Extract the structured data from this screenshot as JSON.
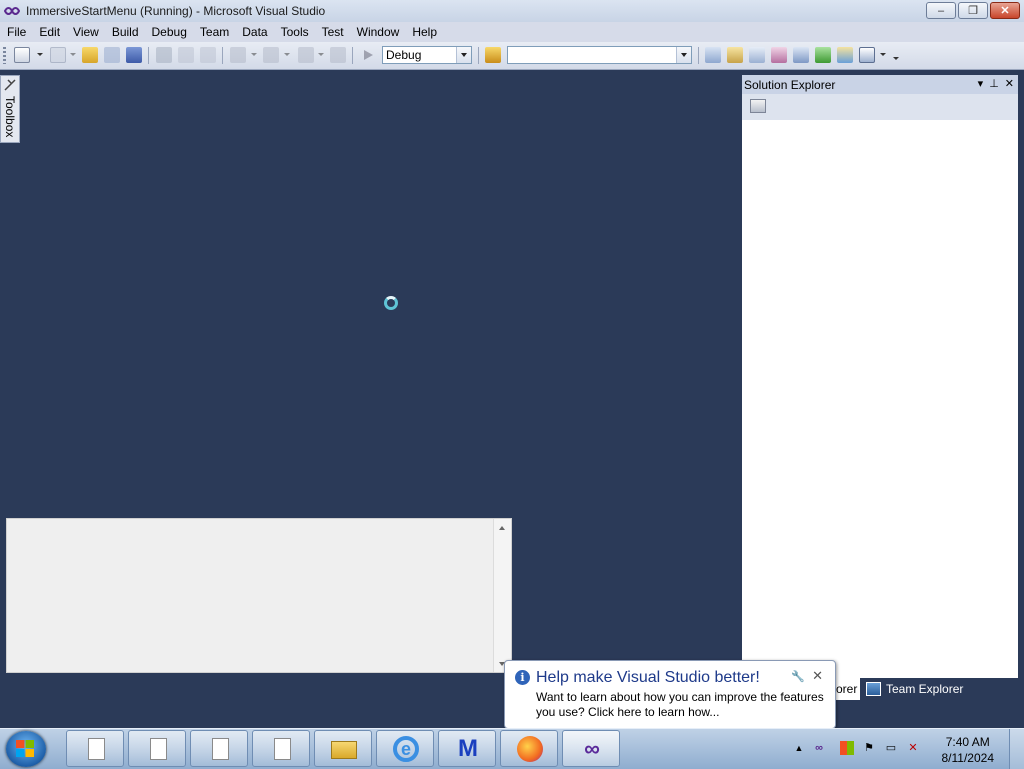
{
  "window": {
    "title": "ImmersiveStartMenu (Running) - Microsoft Visual Studio",
    "controls": {
      "minimize": "–",
      "restore": "❐",
      "close": "✕"
    }
  },
  "menu": [
    "File",
    "Edit",
    "View",
    "Build",
    "Debug",
    "Team",
    "Data",
    "Tools",
    "Test",
    "Window",
    "Help"
  ],
  "toolbar": {
    "configuration": "Debug",
    "platform": ""
  },
  "toolbox": {
    "label": "Toolbox"
  },
  "solution_explorer": {
    "title": "Solution Explorer",
    "header_buttons": {
      "dropdown": "▾",
      "pin": "⊥",
      "close": "✕"
    }
  },
  "bottom_tabs": {
    "active": "Solution Explorer",
    "active_visible": "orer",
    "team": "Team Explorer"
  },
  "balloon": {
    "title": "Help make Visual Studio better!",
    "body": "Want to learn about how you can improve the features you use? Click here to learn how...",
    "info_glyph": "i",
    "settings_glyph": "🔧",
    "close_glyph": "✕"
  },
  "taskbar": {
    "apps": [
      "document",
      "document",
      "document",
      "document",
      "file-explorer",
      "internet-explorer",
      "malwarebytes",
      "firefox",
      "visual-studio"
    ],
    "ie_glyph": "e",
    "mb_glyph": "M",
    "vs_glyph": "∞",
    "clock_time": "7:40 AM",
    "clock_date": "8/11/2024"
  }
}
